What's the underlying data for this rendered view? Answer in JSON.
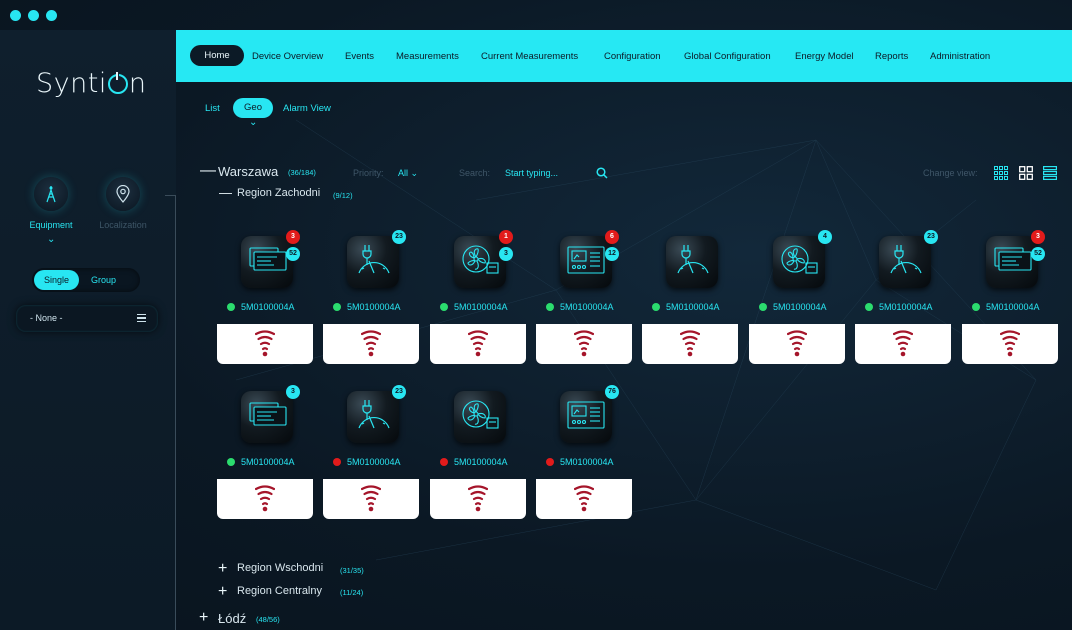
{
  "app": {
    "logo_text_pre": "Synti",
    "logo_text_post": "n"
  },
  "sidebar": {
    "equipment_label": "Equipment",
    "localization_label": "Localization",
    "mode_single": "Single",
    "mode_group": "Group",
    "select_value": "- None -"
  },
  "nav": {
    "items": [
      "Home",
      "Device Overview",
      "Events",
      "Measurements",
      "Current Measurements",
      "Configuration",
      "Global Configuration",
      "Energy Model",
      "Reports",
      "Administration"
    ],
    "active": "Home"
  },
  "subnav": {
    "list": "List",
    "geo": "Geo",
    "alarm": "Alarm View",
    "active": "Geo"
  },
  "filters": {
    "priority_label": "Priority:",
    "priority_value": "All",
    "search_label": "Search:",
    "search_placeholder": "Start typing...",
    "change_view_label": "Change view:"
  },
  "groups": {
    "warszawa": {
      "name": "Warszawa",
      "count": "(36/184)"
    },
    "zachodni": {
      "name": "Region Zachodni",
      "count": "(9/12)"
    },
    "wschodni": {
      "name": "Region Wschodni",
      "count": "(31/35)"
    },
    "centralny": {
      "name": "Region Centralny",
      "count": "(11/24)"
    },
    "lodz": {
      "name": "Łódź",
      "count": "(48/56)"
    }
  },
  "devices": [
    {
      "id": "5M0100004A",
      "icon": "panel-icon",
      "status": "green",
      "badge_red": "3",
      "badge_cyan": "52"
    },
    {
      "id": "5M0100004A",
      "icon": "gauge-icon",
      "status": "green",
      "badge_red": "",
      "badge_cyan": "23"
    },
    {
      "id": "5M0100004A",
      "icon": "fan-icon",
      "status": "green",
      "badge_red": "1",
      "badge_cyan": "3"
    },
    {
      "id": "5M0100004A",
      "icon": "meter-icon",
      "status": "green",
      "badge_red": "6",
      "badge_cyan": "12"
    },
    {
      "id": "5M0100004A",
      "icon": "gauge-icon",
      "status": "green",
      "badge_red": "",
      "badge_cyan": ""
    },
    {
      "id": "5M0100004A",
      "icon": "fan-icon",
      "status": "green",
      "badge_red": "",
      "badge_cyan": "4"
    },
    {
      "id": "5M0100004A",
      "icon": "gauge-icon",
      "status": "green",
      "badge_red": "",
      "badge_cyan": "23"
    },
    {
      "id": "5M0100004A",
      "icon": "panel-icon",
      "status": "green",
      "badge_red": "3",
      "badge_cyan": "52"
    },
    {
      "id": "5M0100004A",
      "icon": "panel-icon",
      "status": "green",
      "badge_red": "",
      "badge_cyan": "3"
    },
    {
      "id": "5M0100004A",
      "icon": "gauge-icon",
      "status": "red",
      "badge_red": "",
      "badge_cyan": "23"
    },
    {
      "id": "5M0100004A",
      "icon": "fan-icon",
      "status": "red",
      "badge_red": "",
      "badge_cyan": ""
    },
    {
      "id": "5M0100004A",
      "icon": "meter-icon",
      "status": "red",
      "badge_red": "",
      "badge_cyan": "76"
    }
  ],
  "colors": {
    "accent": "#26e8f3",
    "ok": "#2bdc6e",
    "alarm": "#e21b1b",
    "signal": "#a5152a"
  }
}
